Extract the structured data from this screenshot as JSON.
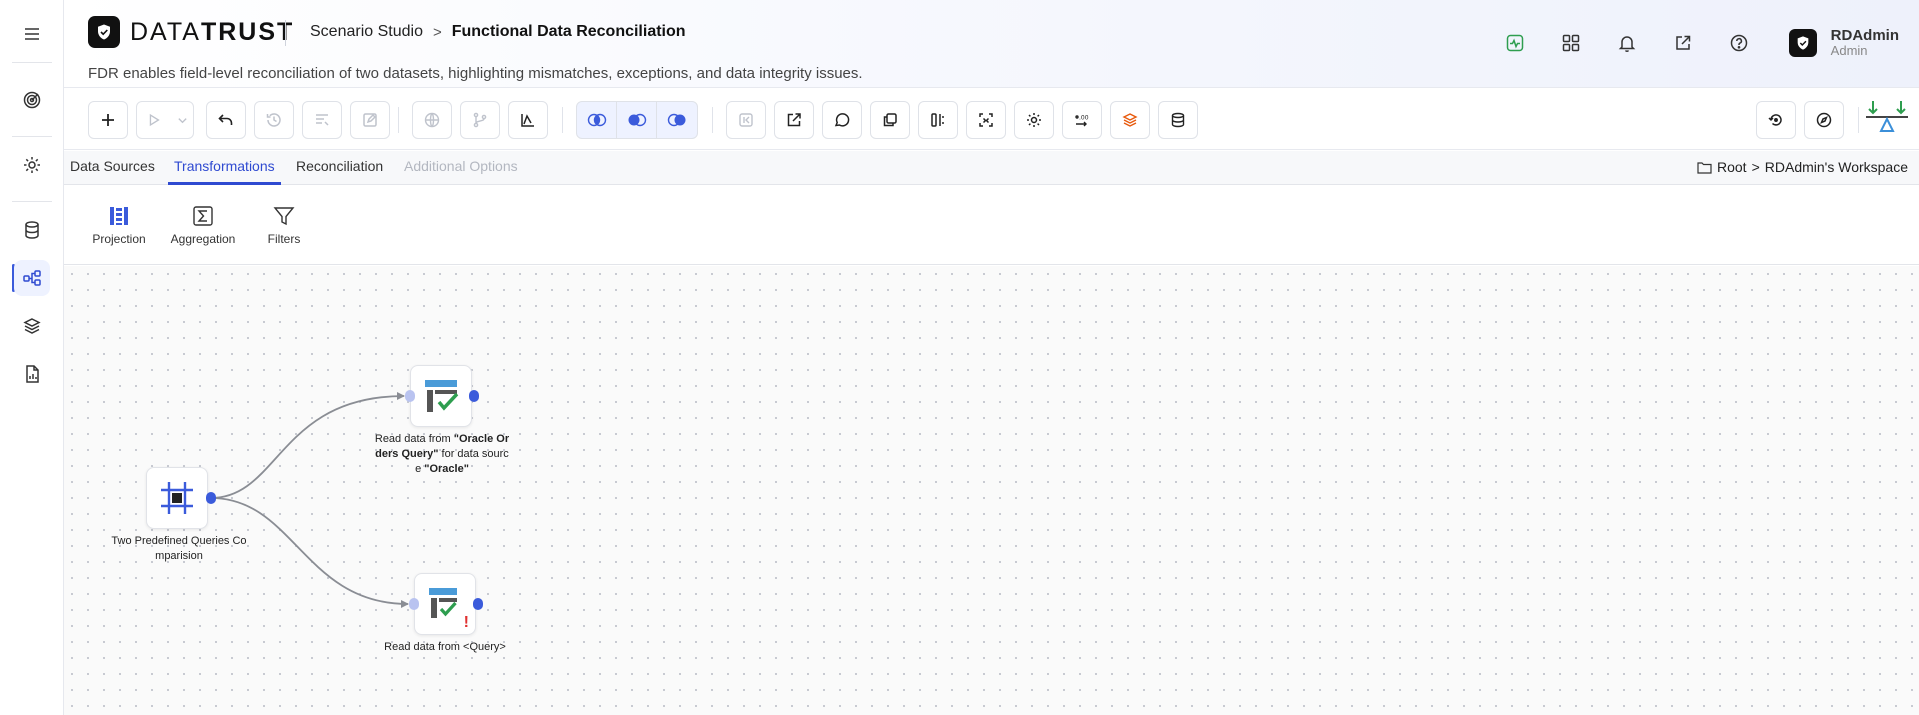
{
  "app": {
    "logo_light": "DATA",
    "logo_bold": "TRUST",
    "breadcrumb_parent": "Scenario Studio",
    "breadcrumb_separator": ">",
    "title": "Functional Data Reconciliation",
    "subtitle": "FDR enables field-level reconciliation of two datasets, highlighting mismatches, exceptions, and data integrity issues."
  },
  "user": {
    "name": "RDAdmin",
    "role": "Admin"
  },
  "colors": {
    "accent": "#2f4ad1",
    "port_out": "#3b5bdb",
    "port_in": "#b9c3f0",
    "success": "#2e9e4f",
    "error": "#e03131"
  },
  "tabs": [
    {
      "label": "Data Sources",
      "state": "normal"
    },
    {
      "label": "Transformations",
      "state": "active"
    },
    {
      "label": "Reconciliation",
      "state": "normal"
    },
    {
      "label": "Additional Options",
      "state": "disabled"
    }
  ],
  "workspace_path": {
    "root": "Root",
    "separator": ">",
    "workspace": "RDAdmin's Workspace"
  },
  "palette": [
    {
      "label": "Projection",
      "icon": "projection-icon"
    },
    {
      "label": "Aggregation",
      "icon": "sigma-icon"
    },
    {
      "label": "Filters",
      "icon": "filter-icon"
    }
  ],
  "nodes": {
    "source": {
      "label_line1": "Two Predefined Queries Co",
      "label_line2": "mparision",
      "icon": "frame-icon"
    },
    "read_oracle": {
      "pre": "Read data from ",
      "q1": "\"Oracle Or",
      "q2": "ders Query\"",
      "mid": " for data sourc",
      "line3_pre": "e ",
      "q3": "\"Oracle\"",
      "icon": "table-check-icon"
    },
    "read_query": {
      "label": "Read data from <Query>",
      "icon": "table-check-warning-icon",
      "warning": "!"
    }
  }
}
